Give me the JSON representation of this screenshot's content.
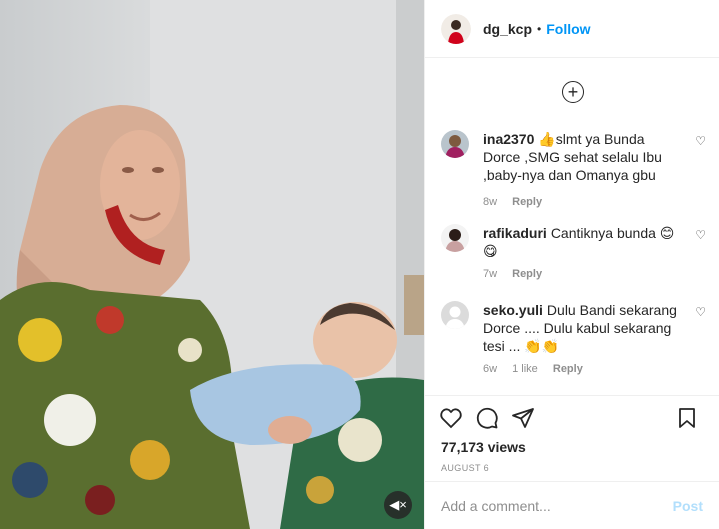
{
  "post": {
    "username": "dg_kcp",
    "separator": "•",
    "follow_label": "Follow",
    "views": "77,173 views",
    "date": "AUGUST 6"
  },
  "comments": [
    {
      "username": "ina2370",
      "text": "👍slmt ya Bunda Dorce ,SMG sehat selalu Ibu ,baby-nya dan Omanya gbu",
      "time": "8w",
      "reply": "Reply"
    },
    {
      "username": "rafikaduri",
      "text": "Cantiknya bunda 😊😋",
      "time": "7w",
      "reply": "Reply"
    },
    {
      "username": "seko.yuli",
      "text": "Dulu Bandi sekarang Dorce .... Dulu kabul sekarang tesi ... 👏👏",
      "time": "6w",
      "likes": "1 like",
      "reply": "Reply"
    }
  ],
  "add_comment": {
    "placeholder": "Add a comment...",
    "post_label": "Post"
  },
  "icons": {
    "load_more": "plus-circle-icon",
    "like": "heart-icon",
    "comment": "comment-bubble-icon",
    "share": "paper-plane-icon",
    "save": "bookmark-icon",
    "sound": "speaker-muted-icon"
  },
  "colors": {
    "follow_blue": "#0095f6",
    "post_disabled": "#b2dffc",
    "muted_text": "#8e8e8e"
  }
}
